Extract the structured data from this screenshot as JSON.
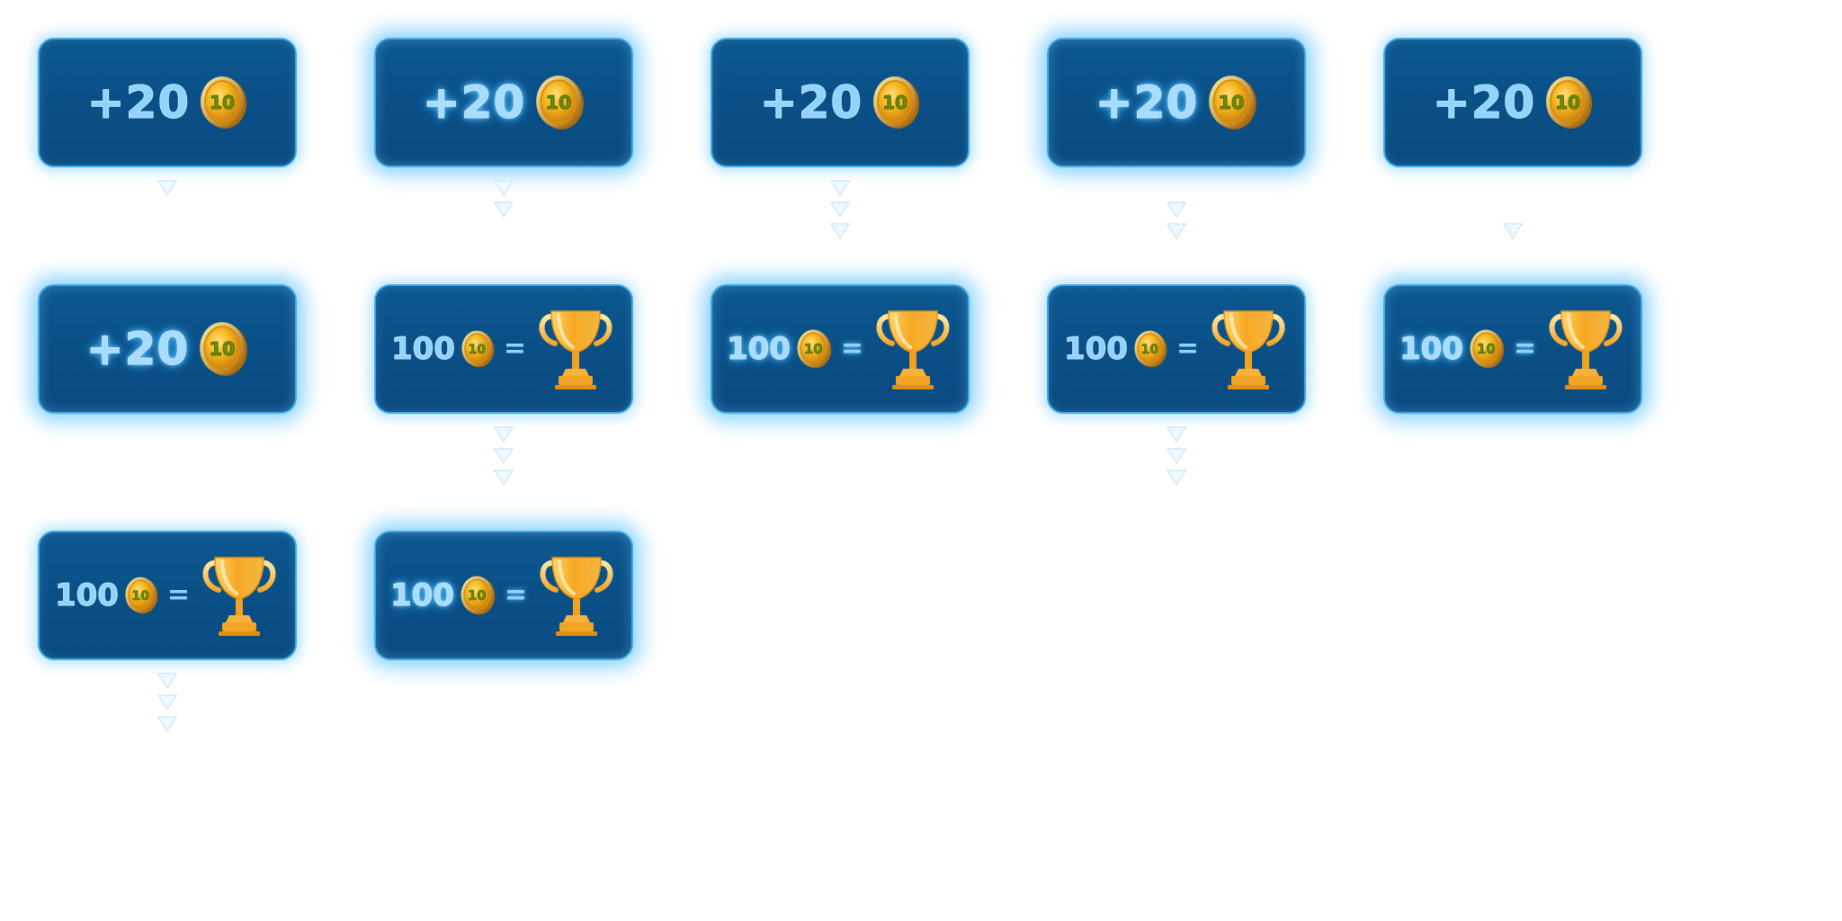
{
  "sheet": {
    "title": "",
    "colors": {
      "card_fill": "#0b5389",
      "card_border": "#3fa9e6",
      "glow": "#6cc9ff",
      "text": "#8fd3ff",
      "coin": "#f2b01e",
      "trophy": "#f6a925"
    }
  },
  "coin_label": "10",
  "cards": [
    {
      "kind": "reward",
      "amount": "+20",
      "icon": "coin-icon",
      "glowing": false,
      "arrow_count": 1
    },
    {
      "kind": "reward",
      "amount": "+20",
      "icon": "coin-icon",
      "glowing": true,
      "arrow_count": 2
    },
    {
      "kind": "reward",
      "amount": "+20",
      "icon": "coin-icon",
      "glowing": false,
      "arrow_count": 3
    },
    {
      "kind": "reward",
      "amount": "+20",
      "icon": "coin-icon",
      "glowing": true,
      "arrow_count": 2
    },
    {
      "kind": "reward",
      "amount": "+20",
      "icon": "coin-icon",
      "glowing": false,
      "arrow_count": 1
    },
    {
      "kind": "reward",
      "amount": "+20",
      "icon": "coin-icon",
      "glowing": true,
      "arrow_count": 0
    },
    {
      "kind": "exchange",
      "amount": "100",
      "equals": "=",
      "icon": "trophy-icon",
      "glowing": false,
      "arrow_count": 3
    },
    {
      "kind": "exchange",
      "amount": "100",
      "equals": "=",
      "icon": "trophy-icon",
      "glowing": true,
      "arrow_count": 0
    },
    {
      "kind": "exchange",
      "amount": "100",
      "equals": "=",
      "icon": "trophy-icon",
      "glowing": false,
      "arrow_count": 3
    },
    {
      "kind": "exchange",
      "amount": "100",
      "equals": "=",
      "icon": "trophy-icon",
      "glowing": true,
      "arrow_count": 0
    },
    {
      "kind": "exchange",
      "amount": "100",
      "equals": "=",
      "icon": "trophy-icon",
      "glowing": false,
      "arrow_count": 3
    },
    {
      "kind": "exchange",
      "amount": "100",
      "equals": "=",
      "icon": "trophy-icon",
      "glowing": true,
      "arrow_count": 0
    }
  ]
}
